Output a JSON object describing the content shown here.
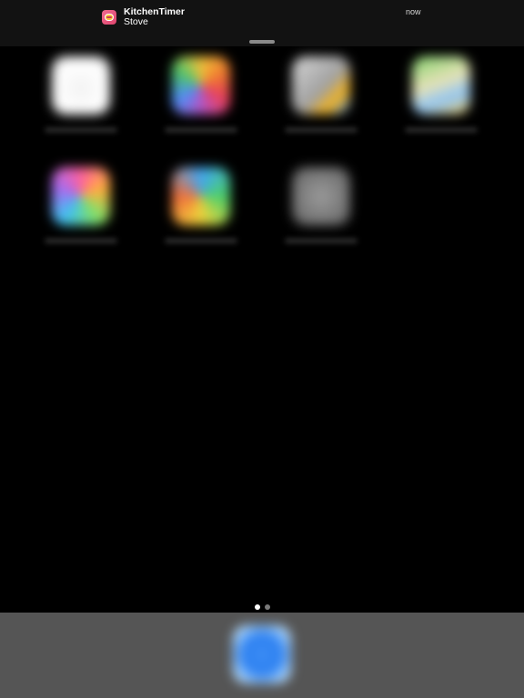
{
  "notification": {
    "app_icon": "kitchen-timer-icon",
    "app_name": "KitchenTimer",
    "message": "Stove",
    "time": "now"
  },
  "home_screen": {
    "icons": [
      {
        "name": "calendar-icon"
      },
      {
        "name": "photos-icon"
      },
      {
        "name": "camera-icon"
      },
      {
        "name": "maps-icon"
      },
      {
        "name": "game-center-icon"
      },
      {
        "name": "app-store-icon"
      },
      {
        "name": "settings-icon"
      }
    ],
    "page_indicator": {
      "current_page": 1,
      "total_pages": 2
    }
  },
  "dock": {
    "icons": [
      {
        "name": "safari-icon"
      }
    ]
  },
  "colors": {
    "background": "#000000",
    "banner": "#121212",
    "dock": "#555555"
  }
}
